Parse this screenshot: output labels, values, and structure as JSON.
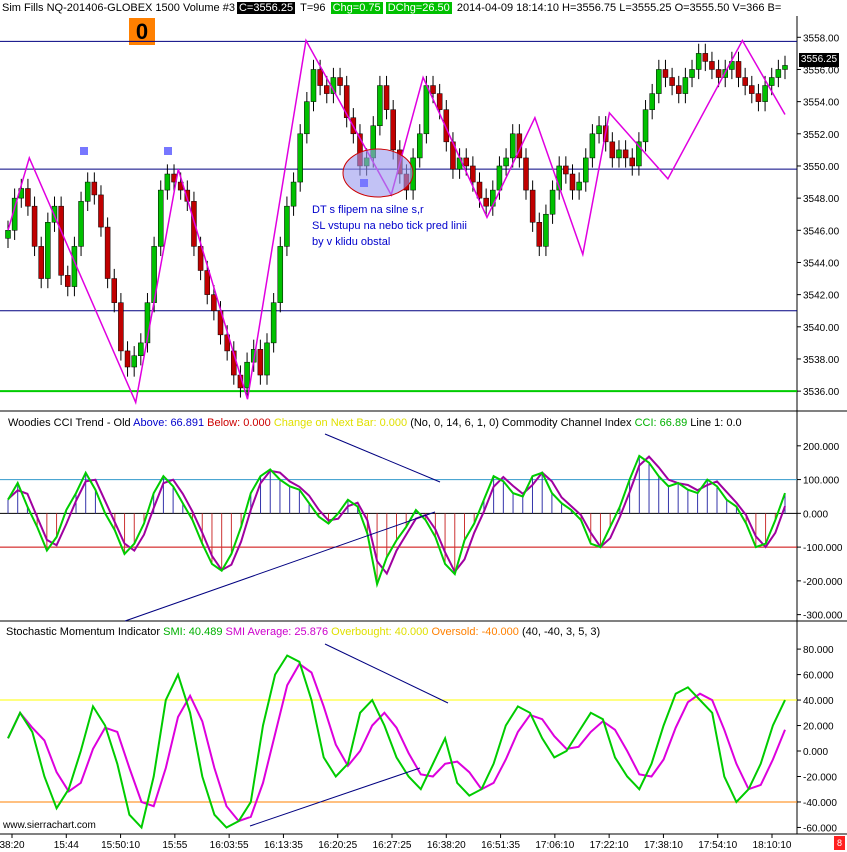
{
  "header": {
    "title": "Sim Fills  NQ-201406-GLOBEX  1500 Volume  #3",
    "close": "C=3556.25",
    "trades": "T=96",
    "chg": "Chg=0.75",
    "dchg": "DChg=26.50",
    "stats": "2014-04-09 18:14:10 H=3556.75 L=3555.25 O=3555.50 V=366 B="
  },
  "position_badge": "0",
  "annotation": {
    "line1": "DT s flipem na silne s,r",
    "line2": "SL vstupu  na nebo tick pred linii",
    "line3": "by v klidu obstal"
  },
  "current_price_label": "3556.25",
  "watermark": "www.sierrachart.com",
  "corner_badge": "8",
  "colors": {
    "up": "#00c000",
    "down": "#c00000",
    "zigzag": "#e000e0",
    "level": "#000080",
    "support": "#00cc00",
    "cci": "#00cc00",
    "cci_old": "#a000a0",
    "smi": "#00cc00",
    "smi_avg": "#dd00dd",
    "overbought": "#ffff00",
    "oversold": "#ff8000"
  },
  "cci_header": {
    "name": "Woodies CCI Trend - Old",
    "above": "Above: 66.891",
    "below": "Below: 0.000",
    "change": "Change on Next Bar: 0.000",
    "params": "(No, 0, 14, 6, 1, 0)",
    "cci_name": "Commodity Channel Index",
    "cci": "CCI: 66.89",
    "line1": "Line 1: 0.0"
  },
  "smi_header": {
    "name": "Stochastic Momentum Indicator",
    "smi": "SMI: 40.489",
    "avg": "SMI Average: 25.876",
    "overbought": "Overbought: 40.000",
    "oversold": "Oversold: -40.000",
    "params": "(40, -40, 3, 5, 3)"
  },
  "chart_data": [
    {
      "type": "candlestick",
      "title": "NQ-201406-GLOBEX 1500 Volume",
      "y_ticks": [
        "3558.00",
        "3556.00",
        "3554.00",
        "3552.00",
        "3550.00",
        "3548.00",
        "3546.00",
        "3544.00",
        "3542.00",
        "3540.00",
        "3538.00",
        "3536.00"
      ],
      "ylim": [
        3535.2,
        3559.2
      ],
      "x_ticks": [
        "38:20",
        "15:44",
        "15:50:10",
        "15:55",
        "16:03:55",
        "16:13:35",
        "16:20:25",
        "16:27:25",
        "16:38:20",
        "16:51:35",
        "17:06:10",
        "17:22:10",
        "17:38:10",
        "17:54:10",
        "18:10:10"
      ],
      "horizontal_levels": [
        3557.75,
        3549.8,
        3541.0,
        3536.0
      ],
      "closes": [
        3546.0,
        3548.0,
        3548.6,
        3547.5,
        3545.0,
        3543.0,
        3546.5,
        3547.5,
        3543.2,
        3542.5,
        3545.0,
        3547.8,
        3549.0,
        3548.2,
        3546.2,
        3543.0,
        3541.5,
        3538.5,
        3537.5,
        3538.2,
        3539.0,
        3541.5,
        3545.0,
        3548.5,
        3549.5,
        3549.0,
        3548.5,
        3547.8,
        3545.0,
        3543.5,
        3542.0,
        3541.0,
        3539.5,
        3538.5,
        3537.0,
        3536.2,
        3537.8,
        3538.6,
        3537.0,
        3539.0,
        3541.5,
        3545.0,
        3547.5,
        3549.0,
        3552.0,
        3554.0,
        3556.0,
        3555.0,
        3554.5,
        3555.5,
        3555.0,
        3553.0,
        3552.0,
        3550.0,
        3550.5,
        3552.5,
        3555.0,
        3553.5,
        3551.0,
        3549.5,
        3548.5,
        3550.5,
        3552.0,
        3555.0,
        3554.5,
        3553.5,
        3551.5,
        3549.8,
        3550.5,
        3550.0,
        3549.0,
        3548.0,
        3547.5,
        3548.5,
        3550.0,
        3550.5,
        3552.0,
        3550.5,
        3548.5,
        3546.5,
        3545.0,
        3547.0,
        3548.5,
        3550.0,
        3549.5,
        3548.5,
        3549.0,
        3550.5,
        3552.0,
        3552.5,
        3551.5,
        3550.5,
        3551.0,
        3550.5,
        3550.0,
        3551.5,
        3553.5,
        3554.5,
        3556.0,
        3555.5,
        3555.0,
        3554.5,
        3555.5,
        3556.0,
        3557.0,
        3556.5,
        3556.0,
        3555.5,
        3556.0,
        3556.5,
        3555.5,
        3555.0,
        3554.5,
        3554.0,
        3555.0,
        3555.5,
        3556.0,
        3556.25
      ],
      "series": [
        {
          "name": "CCI",
          "values": [
            40,
            90,
            20,
            -40,
            -110,
            -70,
            10,
            60,
            120,
            70,
            0,
            -50,
            -120,
            -90,
            -30,
            60,
            110,
            80,
            30,
            -20,
            -90,
            -150,
            -170,
            -120,
            -40,
            60,
            110,
            130,
            100,
            80,
            70,
            30,
            -10,
            -30,
            0,
            40,
            20,
            -60,
            -210,
            -130,
            -80,
            -40,
            10,
            -20,
            -70,
            -150,
            -180,
            -80,
            -30,
            40,
            110,
            95,
            60,
            50,
            110,
            120,
            60,
            30,
            10,
            -20,
            -90,
            -100,
            -40,
            20,
            100,
            170,
            150,
            110,
            80,
            90,
            70,
            60,
            100,
            80,
            40,
            20,
            -30,
            -100,
            -90,
            -20,
            60
          ]
        },
        {
          "name": "SMI",
          "values": [
            10,
            30,
            15,
            -20,
            -45,
            -30,
            0,
            35,
            20,
            -10,
            -50,
            -60,
            -20,
            40,
            60,
            30,
            -20,
            -50,
            -60,
            -55,
            -40,
            20,
            60,
            75,
            70,
            40,
            -5,
            -20,
            -10,
            30,
            40,
            20,
            -5,
            -20,
            -30,
            -10,
            10,
            -25,
            -35,
            -30,
            -10,
            20,
            35,
            30,
            10,
            -5,
            0,
            15,
            30,
            25,
            -5,
            -20,
            -30,
            -10,
            20,
            45,
            50,
            40,
            30,
            -20,
            -40,
            -30,
            -10,
            20,
            40
          ]
        }
      ],
      "cci_y_ticks": [
        "200.000",
        "100.000",
        "0.000",
        "-100.000",
        "-200.000",
        "-300.000"
      ],
      "smi_y_ticks": [
        "80.000",
        "60.000",
        "40.000",
        "20.000",
        "0.000",
        "-20.000",
        "-40.000",
        "-60.000"
      ]
    }
  ]
}
